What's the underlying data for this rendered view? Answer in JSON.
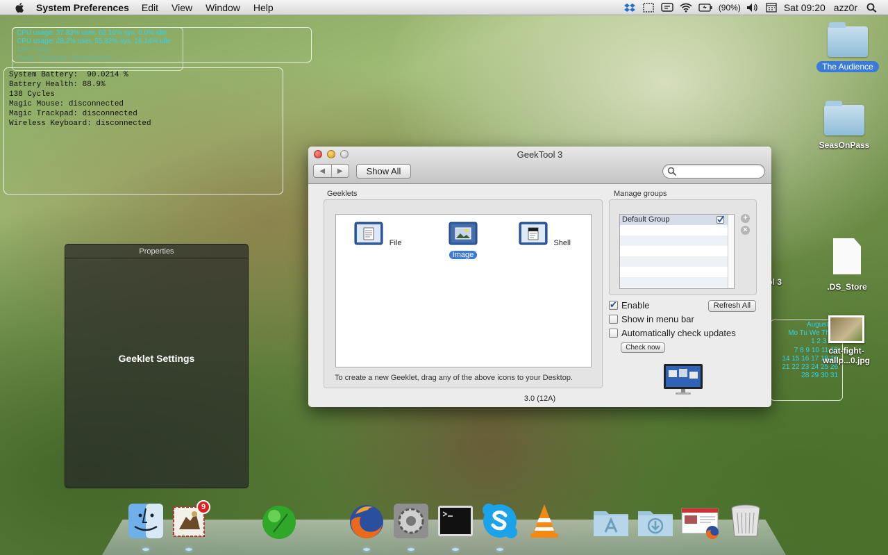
{
  "menubar": {
    "app": "System Preferences",
    "items": [
      "Edit",
      "View",
      "Window",
      "Help"
    ],
    "battery": "(90%)",
    "clock": "Sat 09:20",
    "user": "azz0r"
  },
  "desktop_geeklets": {
    "cpu_lines": [
      "CPU usage: 37.83% user, 62.16% sys, 0.0% idle",
      "CPU usage: 28.2% user, 55.82% sys, 16.14% idle",
      "138 Cycles",
      "Magic Trackpad: disconnected"
    ],
    "battery_lines": [
      "System Battery:  90.0214 %",
      "Battery Health: 88.9%",
      "138 Cycles",
      "Magic Mouse: disconnected",
      "Magic Trackpad: disconnected",
      "Wireless Keyboard: disconnected"
    ],
    "calendar_lines": [
      "August 20",
      "Mo Tu We Th Fr",
      "1  2  3  4  5",
      "7  8  9 10 11 12",
      "14 15 16 17 18 19",
      "21 22 23 24 25 26",
      "28 29 30 31"
    ]
  },
  "properties_panel": {
    "title": "Properties",
    "center_text": "Geeklet Settings"
  },
  "desktop_icons": {
    "audience": "The Audience",
    "seas": "SeasOnPass",
    "tool3": "ool 3",
    "ds_store": ".DS_Store",
    "cat_fight_line1": "cat-fight-",
    "cat_fight_line2": "wallp...0.jpg"
  },
  "window": {
    "title": "GeekTool 3",
    "show_all": "Show All",
    "search_placeholder": "",
    "geeklets_label": "Geeklets",
    "geeklet_types": [
      "File",
      "Image",
      "Shell"
    ],
    "selected_geeklet": "Image",
    "hint": "To create a new Geeklet, drag any of the above icons to your Desktop.",
    "manage_groups_label": "Manage groups",
    "groups": [
      "Default Group"
    ],
    "enable": "Enable",
    "show_menu_bar": "Show in menu bar",
    "auto_updates": "Automatically check updates",
    "check_now": "Check now",
    "refresh_all": "Refresh All",
    "version": "3.0 (12A)"
  },
  "dock": {
    "mail_badge": "9",
    "apps": [
      "finder",
      "mail",
      "green-ball",
      "firefox",
      "system-preferences",
      "terminal",
      "skype",
      "vlc",
      "applications-folder",
      "downloads-folder",
      "firefox-window",
      "trash"
    ]
  },
  "colors": {
    "selection_blue": "#3b7ad6",
    "geeklet_text_cyan": "#2fd4f0"
  }
}
